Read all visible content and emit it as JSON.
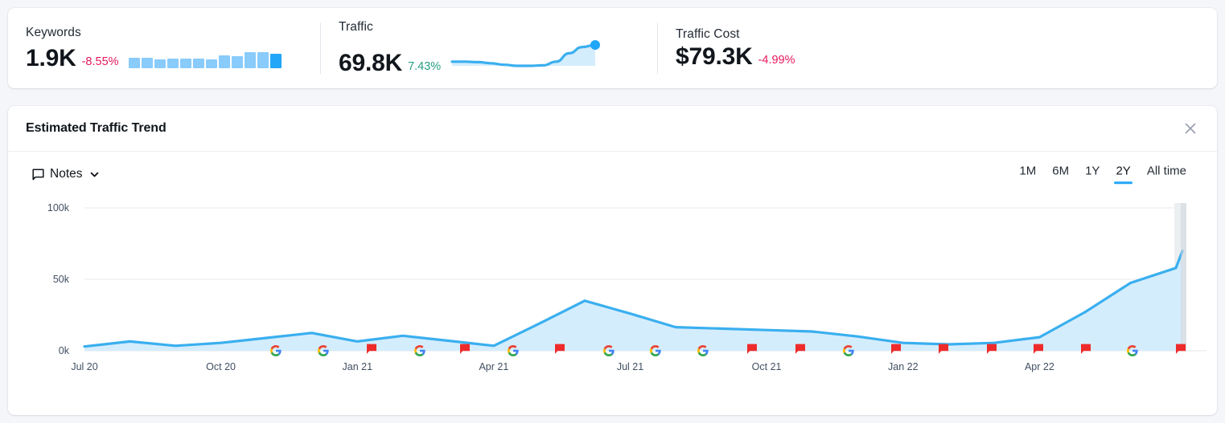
{
  "kpis": [
    {
      "label": "Keywords",
      "value": "1.9K",
      "delta": "-8.55%",
      "delta_sign": "neg",
      "sparkline_type": "bars",
      "sparkline_values": [
        40,
        40,
        36,
        37,
        38,
        38,
        35,
        50,
        47,
        62,
        62,
        58
      ]
    },
    {
      "label": "Traffic",
      "value": "69.8K",
      "delta": "7.43%",
      "delta_sign": "pos",
      "sparkline_type": "area",
      "sparkline_values": [
        30,
        30,
        29,
        27,
        24,
        22,
        22,
        23,
        30,
        46,
        58,
        62
      ]
    },
    {
      "label": "Traffic Cost",
      "value": "$79.3K",
      "delta": "-4.99%",
      "delta_sign": "neg",
      "sparkline_type": "none",
      "sparkline_values": []
    }
  ],
  "panel": {
    "title": "Estimated Traffic Trend",
    "close_icon": "close-icon",
    "notes_label": "Notes",
    "notes_icon": "note-bubble-icon",
    "notes_caret_icon": "chevron-down-icon",
    "ranges": [
      {
        "label": "1M",
        "active": false
      },
      {
        "label": "6M",
        "active": false
      },
      {
        "label": "1Y",
        "active": false
      },
      {
        "label": "2Y",
        "active": true
      },
      {
        "label": "All time",
        "active": false
      }
    ]
  },
  "colors": {
    "accent": "#22a6f7",
    "line": "#3aafef",
    "area": "#d4edfd",
    "negative": "#e5175c",
    "positive": "#259e82",
    "grid": "#e8eaef",
    "forecast_band": "#e9ecef"
  },
  "chart_data": {
    "type": "area",
    "title": "Estimated Traffic Trend",
    "xlabel": "",
    "ylabel": "",
    "ylim": [
      0,
      100000
    ],
    "yticks": [
      0,
      50000,
      100000
    ],
    "ytick_labels": [
      "0k",
      "50k",
      "100k"
    ],
    "grid": true,
    "legend": false,
    "xtick_labels": [
      "Jul 20",
      "Oct 20",
      "Jan 21",
      "Apr 21",
      "Jul 21",
      "Oct 21",
      "Jan 22",
      "Apr 22"
    ],
    "x": [
      "Jul 20",
      "Aug 20",
      "Sep 20",
      "Oct 20",
      "Nov 20",
      "Dec 20",
      "Jan 21",
      "Feb 21",
      "Mar 21",
      "Apr 21",
      "May 21",
      "Jun 21",
      "Jul 21",
      "Aug 21",
      "Sep 21",
      "Oct 21",
      "Nov 21",
      "Dec 21",
      "Jan 22",
      "Feb 22",
      "Mar 22",
      "Apr 22",
      "May 22",
      "Jun 22",
      "Jul 22"
    ],
    "values": [
      3000,
      6500,
      3500,
      5500,
      9000,
      12500,
      6500,
      10500,
      7000,
      3500,
      19000,
      35000,
      26000,
      16500,
      15500,
      14500,
      13500,
      10000,
      5500,
      4500,
      5500,
      9500,
      27000,
      47500,
      58000
    ],
    "final_value": 69800,
    "annotations": [
      {
        "type": "google-update-marker",
        "x": "Dec 20"
      },
      {
        "type": "google-update-marker",
        "x": "Dec 20"
      },
      {
        "type": "note-flag-marker",
        "x": "Jan 21"
      },
      {
        "type": "google-update-marker",
        "x": "Jan 21"
      },
      {
        "type": "note-flag-marker",
        "x": "Feb 21"
      },
      {
        "type": "google-update-marker",
        "x": "Mar 21"
      },
      {
        "type": "note-flag-marker",
        "x": "Apr 21"
      },
      {
        "type": "google-update-marker",
        "x": "Apr 21"
      },
      {
        "type": "google-update-marker",
        "x": "May 21"
      },
      {
        "type": "google-update-marker",
        "x": "Jun 21"
      },
      {
        "type": "note-flag-marker",
        "x": "Jul 21"
      },
      {
        "type": "note-flag-marker",
        "x": "Jul 21"
      },
      {
        "type": "google-update-marker",
        "x": "Aug 21"
      },
      {
        "type": "note-flag-marker",
        "x": "Sep 21"
      },
      {
        "type": "note-flag-marker",
        "x": "Oct 21"
      },
      {
        "type": "note-flag-marker",
        "x": "Nov 21"
      },
      {
        "type": "note-flag-marker",
        "x": "Dec 21"
      },
      {
        "type": "note-flag-marker",
        "x": "Feb 22"
      },
      {
        "type": "google-update-marker",
        "x": "Apr 22"
      },
      {
        "type": "note-flag-marker",
        "x": "Jun 22"
      }
    ]
  },
  "marker_positions": {
    "google": [
      333,
      392,
      512,
      628,
      747,
      805,
      864,
      1045,
      1398
    ],
    "flag": [
      452,
      568,
      686,
      925,
      985,
      1104,
      1163,
      1223,
      1281,
      1340,
      1458
    ]
  }
}
